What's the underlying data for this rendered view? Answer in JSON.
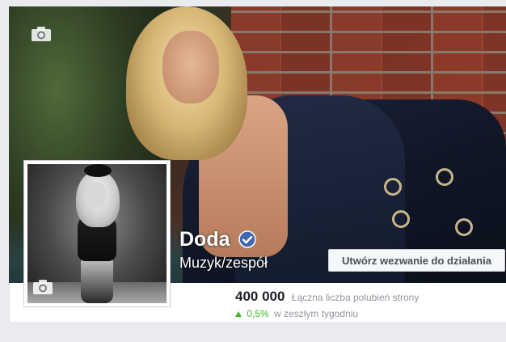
{
  "page": {
    "name": "Doda",
    "category": "Muzyk/zespół",
    "verified_icon": "verified-badge-icon",
    "accent_color": "#4267b2"
  },
  "cover": {
    "camera_icon": "camera-icon"
  },
  "profile": {
    "camera_icon": "camera-icon"
  },
  "cta": {
    "label": "Utwórz wezwanie do działania"
  },
  "stats": {
    "likes_count": "400 000",
    "likes_label": "Łączna liczba polubień strony",
    "growth_value": "0,5%",
    "growth_label": "w zeszłym tygodniu",
    "growth_color": "#42b72a"
  }
}
